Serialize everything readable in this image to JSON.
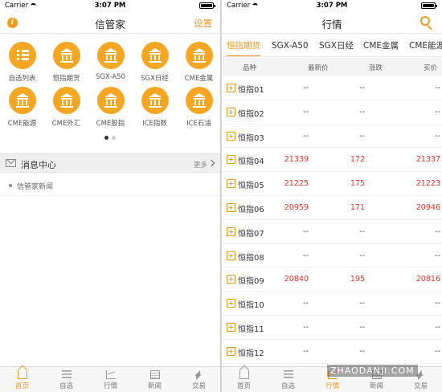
{
  "left": {
    "status": {
      "carrier": "Carrier",
      "time": "3:07 PM"
    },
    "nav": {
      "title": "信管家",
      "settings": "设置",
      "info_icon": "i"
    },
    "grid": [
      {
        "label": "自选列表",
        "icon": "list-icon"
      },
      {
        "label": "恒指期货",
        "icon": "bank-icon"
      },
      {
        "label": "SGX-A50",
        "icon": "bank-icon"
      },
      {
        "label": "SGX日经",
        "icon": "bank-icon"
      },
      {
        "label": "CME金属",
        "icon": "bank-icon"
      },
      {
        "label": "CME能源",
        "icon": "bank-icon"
      },
      {
        "label": "CME外汇",
        "icon": "bank-icon"
      },
      {
        "label": "CME股指",
        "icon": "bank-icon"
      },
      {
        "label": "ICE指数",
        "icon": "bank-icon"
      },
      {
        "label": "ICE石油",
        "icon": "bank-icon"
      }
    ],
    "pager": {
      "pages": 2,
      "current": 1
    },
    "messages": {
      "title": "消息中心",
      "more": "更多",
      "items": [
        "信管家新闻"
      ]
    }
  },
  "right": {
    "status": {
      "carrier": "Carrier",
      "time": "3:07 PM"
    },
    "nav": {
      "title": "行情"
    },
    "categories": [
      "恒指期货",
      "SGX-A50",
      "SGX日经",
      "CME金属",
      "CME能源"
    ],
    "active_category": 0,
    "columns": [
      "品种",
      "最新价",
      "涨跌",
      "买价"
    ],
    "rows": [
      {
        "name": "恒指01",
        "last": "--",
        "change": "--",
        "bid": "--",
        "up": false
      },
      {
        "name": "恒指02",
        "last": "--",
        "change": "--",
        "bid": "--",
        "up": false
      },
      {
        "name": "恒指03",
        "last": "--",
        "change": "--",
        "bid": "--",
        "up": false
      },
      {
        "name": "恒指04",
        "last": "21339",
        "change": "172",
        "bid": "21337",
        "up": true
      },
      {
        "name": "恒指05",
        "last": "21225",
        "change": "175",
        "bid": "21223",
        "up": true
      },
      {
        "name": "恒指06",
        "last": "20959",
        "change": "171",
        "bid": "20946",
        "up": true
      },
      {
        "name": "恒指07",
        "last": "--",
        "change": "--",
        "bid": "--",
        "up": false
      },
      {
        "name": "恒指08",
        "last": "--",
        "change": "--",
        "bid": "--",
        "up": false
      },
      {
        "name": "恒指09",
        "last": "20840",
        "change": "195",
        "bid": "20816",
        "up": true
      },
      {
        "name": "恒指10",
        "last": "--",
        "change": "--",
        "bid": "--",
        "up": false
      },
      {
        "name": "恒指11",
        "last": "--",
        "change": "--",
        "bid": "--",
        "up": false
      },
      {
        "name": "恒指12",
        "last": "--",
        "change": "--",
        "bid": "--",
        "up": false
      }
    ]
  },
  "tabbar": {
    "items": [
      {
        "label": "首页",
        "icon": "home-icon"
      },
      {
        "label": "自选",
        "icon": "list-icon"
      },
      {
        "label": "行情",
        "icon": "chart-icon"
      },
      {
        "label": "新闻",
        "icon": "news-icon"
      },
      {
        "label": "交易",
        "icon": "trade-icon"
      }
    ],
    "left_active": 0,
    "right_active": 2
  },
  "watermark": "ZHAODANJI.COM",
  "colors": {
    "accent": "#f19a1e",
    "up": "#e8332b",
    "icon_bg": "#f5a623"
  }
}
